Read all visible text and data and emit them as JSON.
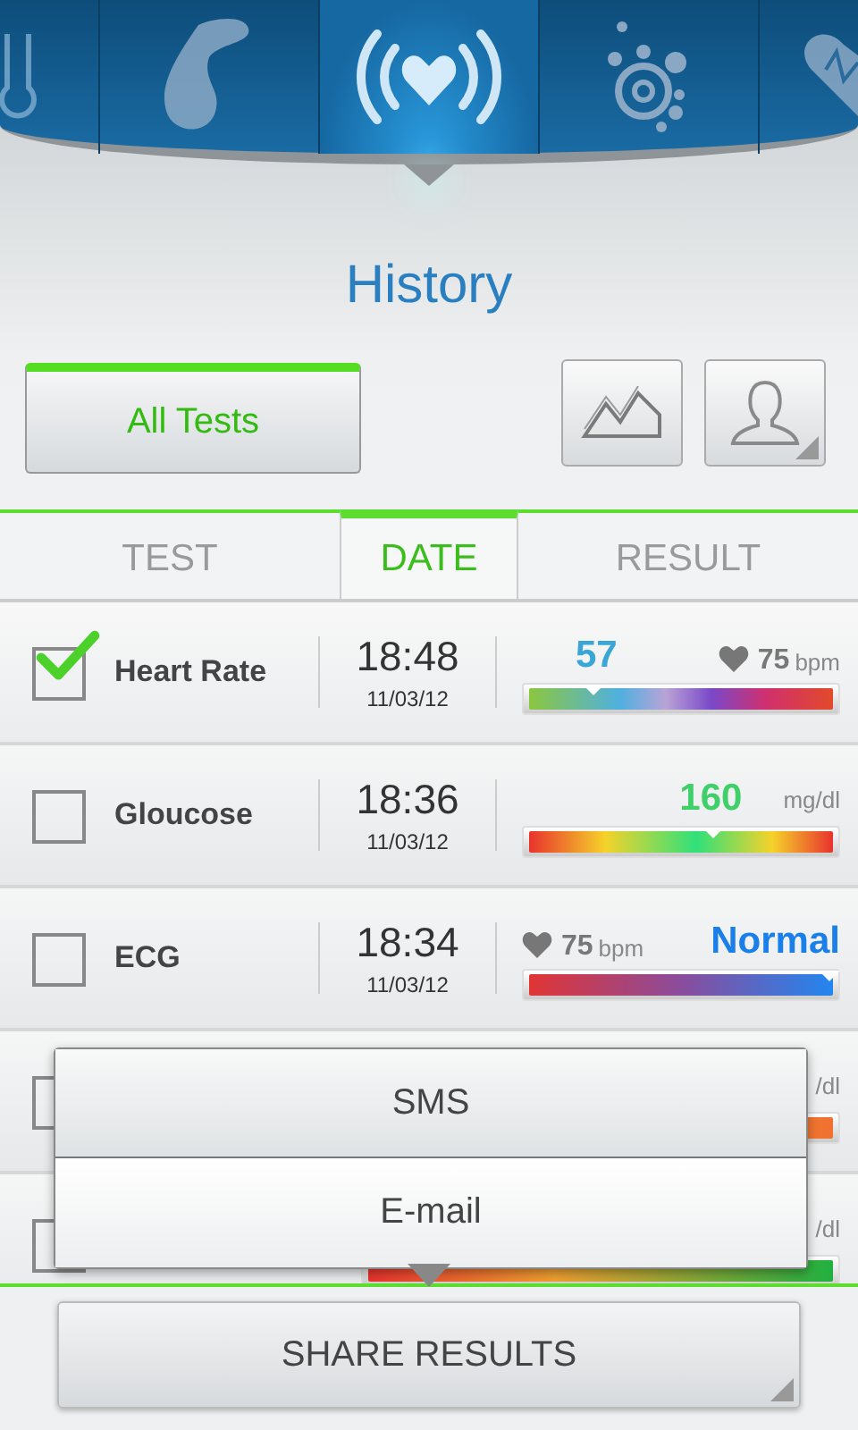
{
  "header_icons": [
    {
      "kind": "thermometer",
      "selected": false
    },
    {
      "kind": "drop",
      "selected": false
    },
    {
      "kind": "heart-signal",
      "selected": true
    },
    {
      "kind": "oxygen",
      "selected": false
    },
    {
      "kind": "heart-pulse",
      "selected": false
    }
  ],
  "title": "History",
  "filter_button": {
    "label": "All Tests",
    "selected": true
  },
  "columns": [
    {
      "label": "TEST",
      "selected": false
    },
    {
      "label": "DATE",
      "selected": true
    },
    {
      "label": "RESULT",
      "selected": false
    }
  ],
  "rows": [
    {
      "kind": "heart-rate",
      "name": "Heart Rate",
      "checked": true,
      "time": "18:48",
      "date": "11/03/12",
      "value": "57",
      "color": "#3aa6d6",
      "bpm": "75",
      "unit": "bpm",
      "level": 0.22
    },
    {
      "kind": "glucose",
      "name": "Gloucose",
      "checked": false,
      "time": "18:36",
      "date": "11/03/12",
      "value": "160",
      "color": "#3fd06a",
      "unit": "mg/dl",
      "level": 0.6
    },
    {
      "kind": "ecg",
      "name": "ECG",
      "checked": false,
      "time": "18:34",
      "date": "11/03/12",
      "value": "Normal",
      "color": "#1a7fe8",
      "bpm": "75",
      "unit": "bpm",
      "level": 0.97
    },
    {
      "kind": "hidden",
      "checked": false,
      "unit": "/dl"
    },
    {
      "kind": "hidden",
      "checked": false,
      "unit": "/dl"
    }
  ],
  "share_menu": {
    "items": [
      {
        "label": "SMS"
      },
      {
        "label": "E-mail"
      }
    ]
  },
  "share_button": {
    "label": "SHARE RESULTS"
  }
}
